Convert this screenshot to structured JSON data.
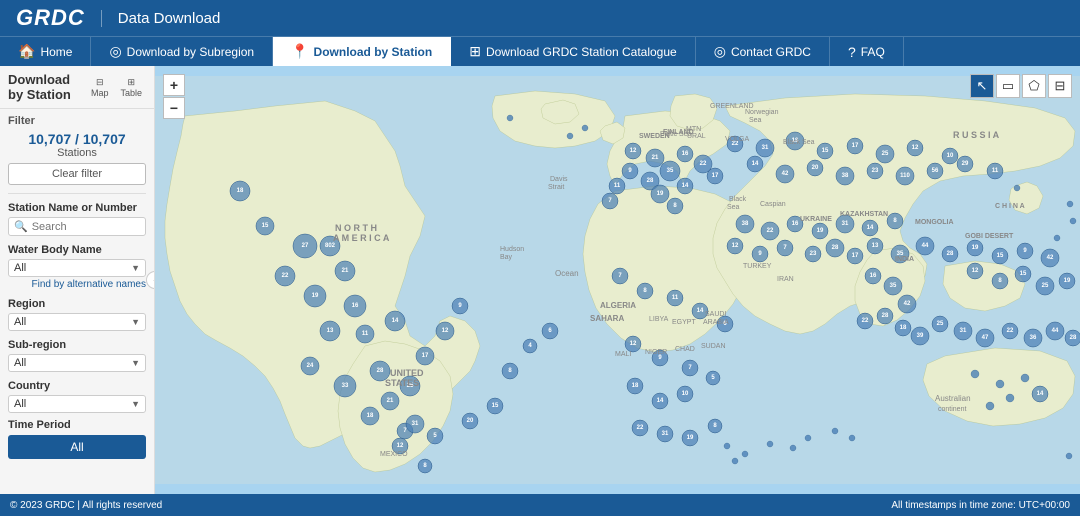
{
  "app": {
    "logo": "GRDC",
    "title": "Data Download"
  },
  "nav": {
    "items": [
      {
        "id": "home",
        "label": "Home",
        "icon": "🏠",
        "active": false
      },
      {
        "id": "download-subregion",
        "label": "Download by Subregion",
        "icon": "◎",
        "active": false
      },
      {
        "id": "download-station",
        "label": "Download by Station",
        "icon": "📍",
        "active": true
      },
      {
        "id": "station-catalogue",
        "label": "Download GRDC Station Catalogue",
        "icon": "⊞",
        "active": false
      },
      {
        "id": "contact",
        "label": "Contact GRDC",
        "icon": "◎",
        "active": false
      },
      {
        "id": "faq",
        "label": "FAQ",
        "icon": "?",
        "active": false
      }
    ]
  },
  "sidebar": {
    "page_title": "Download by Station",
    "view_map_label": "Map",
    "view_table_label": "Table",
    "filter_section_label": "Filter",
    "station_count_current": "10,707",
    "station_count_total": "10,707",
    "station_label": "Stations",
    "clear_filter_label": "Clear filter",
    "station_name_label": "Station Name or Number",
    "search_placeholder": "Search",
    "water_body_label": "Water Body Name",
    "water_body_value": "All",
    "alt_names_link": "Find by alternative names",
    "region_label": "Region",
    "region_value": "All",
    "subregion_label": "Sub-region",
    "subregion_value": "All",
    "country_label": "Country",
    "country_value": "All",
    "time_period_label": "Time Period",
    "all_btn_label": "All"
  },
  "footer": {
    "copyright": "© 2023 GRDC  |  All rights reserved",
    "timezone": "All timestamps in time zone: UTC+00:00"
  },
  "map_tools": [
    "cursor",
    "rectangle",
    "polygon",
    "layers"
  ]
}
